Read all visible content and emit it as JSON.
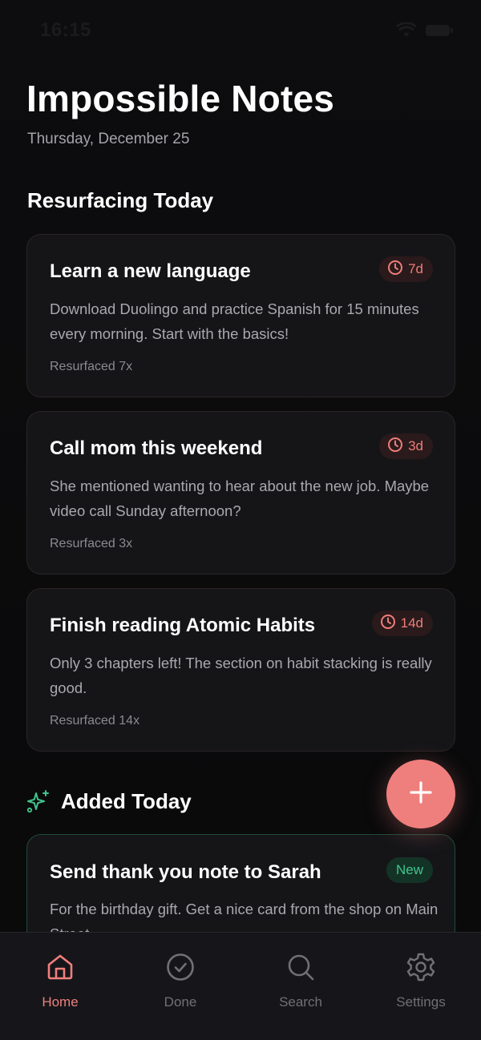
{
  "status_bar": {
    "time": "16:15"
  },
  "app": {
    "title": "Impossible Notes",
    "date": "Thursday, December 25"
  },
  "sections": {
    "resurfacing_title": "Resurfacing Today",
    "added_title": "Added Today"
  },
  "resurfacing_notes": [
    {
      "title": "Learn a new language",
      "body": "Download Duolingo and practice Spanish for 15 minutes every morning. Start with the basics!",
      "badge": "7d",
      "meta": "Resurfaced 7x"
    },
    {
      "title": "Call mom this weekend",
      "body": "She mentioned wanting to hear about the new job. Maybe video call Sunday afternoon?",
      "badge": "3d",
      "meta": "Resurfaced 3x"
    },
    {
      "title": "Finish reading Atomic Habits",
      "body": "Only 3 chapters left! The section on habit stacking is really good.",
      "badge": "14d",
      "meta": "Resurfaced 14x"
    }
  ],
  "added_notes": [
    {
      "title": "Send thank you note to Sarah",
      "body": "For the birthday gift. Get a nice card from the shop on Main Street.",
      "badge": "New"
    }
  ],
  "tabs": [
    {
      "label": "Home",
      "icon": "home-icon",
      "active": true
    },
    {
      "label": "Done",
      "icon": "check-circle-icon",
      "active": false
    },
    {
      "label": "Search",
      "icon": "search-icon",
      "active": false
    },
    {
      "label": "Settings",
      "icon": "gear-icon",
      "active": false
    }
  ],
  "colors": {
    "accent": "#ef7f7d",
    "new_green": "#3fc58c",
    "background": "#0a0a0b",
    "card": "#151518"
  }
}
